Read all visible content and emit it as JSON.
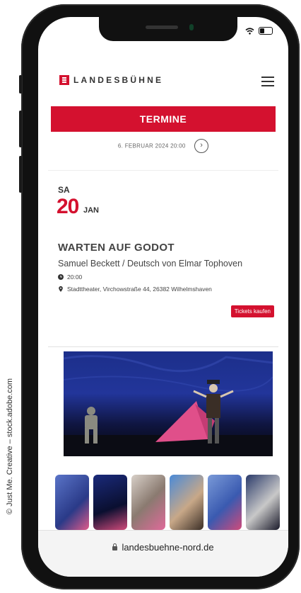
{
  "credit": "© Just Me. Creative – stock.adobe.com",
  "header": {
    "logo_text": "LANDESBÜHNE"
  },
  "termine_label": "TERMINE",
  "date_nav": {
    "date_text": "6. FEBRUAR 2024 20:00"
  },
  "event": {
    "weekday": "SA",
    "day": "20",
    "month": "JAN",
    "title": "WARTEN AUF GODOT",
    "subtitle": "Samuel Beckett / Deutsch von Elmar Tophoven",
    "time": "20:00",
    "venue": "Stadttheater, Virchowstraße 44, 26382 Wilhelmshaven",
    "tickets_label": "Tickets kaufen"
  },
  "browser": {
    "url": "landesbuehne-nord.de"
  },
  "colors": {
    "accent": "#d4112f",
    "stage_blue": "#22359a"
  },
  "icons": [
    "wifi-icon",
    "battery-icon",
    "hamburger-icon",
    "chevron-right-icon",
    "clock-icon",
    "location-pin-icon",
    "lock-icon"
  ]
}
